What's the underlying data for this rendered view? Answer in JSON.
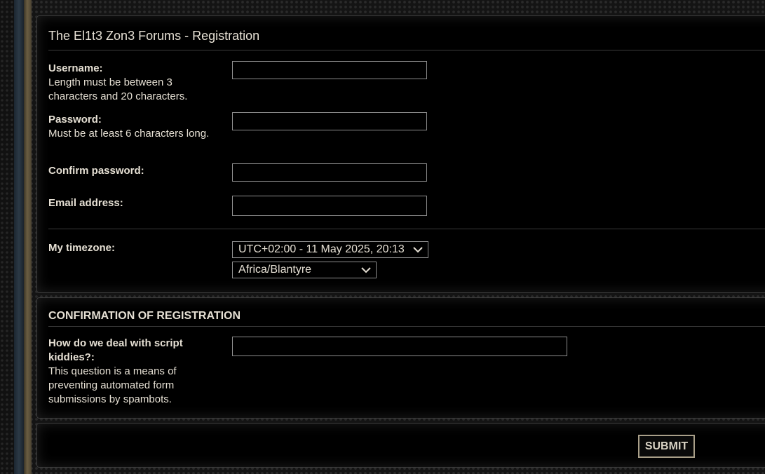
{
  "form": {
    "title": "The El1t3 Zon3 Forums - Registration",
    "username_label": "Username:",
    "username_hint": "Length must be between 3 characters and 20 characters.",
    "username_value": "",
    "password_label": "Password:",
    "password_hint": "Must be at least 6 characters long.",
    "password_value": "",
    "confirm_label": "Confirm password:",
    "confirm_value": "",
    "email_label": "Email address:",
    "email_value": "",
    "timezone_label": "My timezone:",
    "timezone_offset": "UTC+02:00 - 11 May 2025, 20:13",
    "timezone_zone": "Africa/Blantyre"
  },
  "confirmation": {
    "heading": "CONFIRMATION OF REGISTRATION",
    "question_label": "How do we deal with script kiddies?:",
    "question_hint": "This question is a means of preventing automated form submissions by spambots.",
    "answer_value": ""
  },
  "actions": {
    "submit_label": "SUBMIT"
  },
  "colors": {
    "panel_bg": "#000000",
    "text": "#e6e0d4",
    "border": "#8e8e8e",
    "accent_gold": "#a99f89"
  }
}
